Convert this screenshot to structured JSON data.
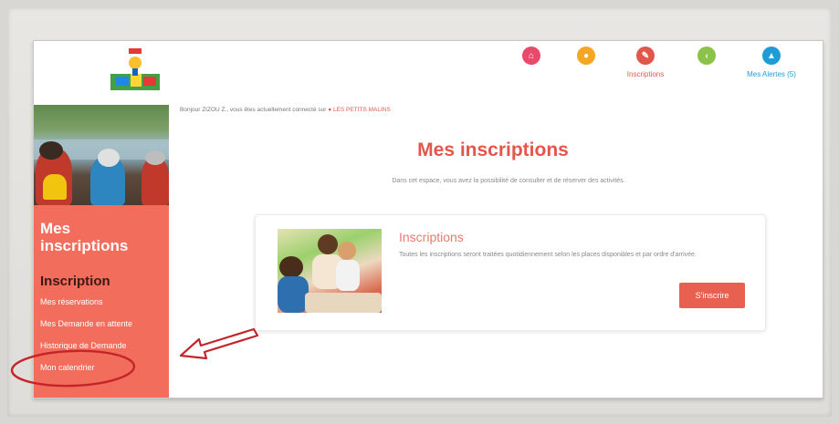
{
  "nav": {
    "items": [
      {
        "label": "",
        "color": "#e94a6b",
        "icon": "home-icon",
        "glyph": "⌂"
      },
      {
        "label": "",
        "color": "#f5a623",
        "icon": "drop-icon",
        "glyph": "●"
      },
      {
        "label": "Inscriptions",
        "color": "#e2574c",
        "icon": "pencil-icon",
        "glyph": "✎"
      },
      {
        "label": "",
        "color": "#8bc34a",
        "icon": "chevron-left-icon",
        "glyph": "‹"
      },
      {
        "label": "Mes Alertes (5)",
        "color": "#1e9cd7",
        "icon": "alert-icon",
        "glyph": "▲"
      }
    ]
  },
  "greeting": {
    "text": "Bonjour ZIZOU Z., vous êtes actuellement connecté sur",
    "site": "LES PETITS MALINS"
  },
  "sidebar": {
    "title": "Mes inscriptions",
    "heading": "Inscription",
    "links": [
      "Mes réservations",
      "Mes Demande en attente",
      "Historique de Demande",
      "Mon calendrier"
    ]
  },
  "main": {
    "title": "Mes inscriptions",
    "subtitle": "Dans cet espace, vous avez la possibilité de consulter et de réserver des activités.",
    "card": {
      "title": "Inscriptions",
      "text": "Toutes les inscriptions seront traitées quotidiennement selon les places disponibles et par ordre d'arrivée.",
      "button": "S'inscrire"
    }
  },
  "colors": {
    "accent": "#e2574c",
    "sidebar": "#f26d5b",
    "annotation": "#c4252b"
  }
}
